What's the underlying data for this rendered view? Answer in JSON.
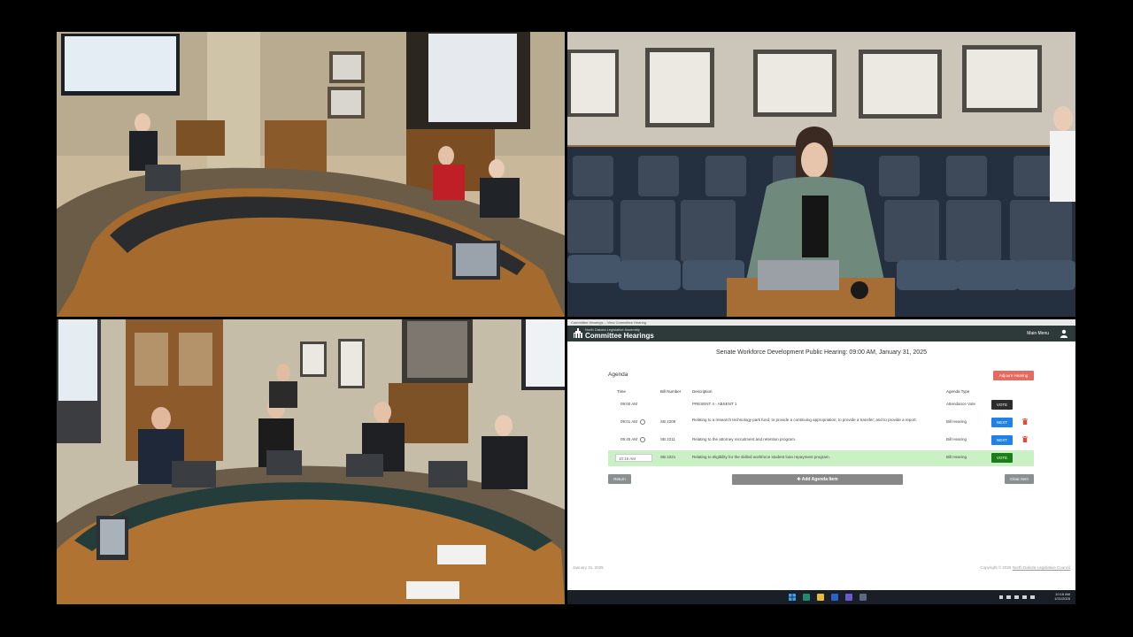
{
  "browser": {
    "title": "Committee Hearings – View Committee Hearing"
  },
  "app": {
    "org": "North Dakota Legislative Assembly",
    "title": "Committee Hearings",
    "menu_label": "Main Menu"
  },
  "hearing_title": "Senate Workforce Development Public Hearing: 09:00 AM, January 31, 2025",
  "agenda": {
    "label": "Agenda",
    "adjourn_label": "Adjourn Hearing",
    "headers": {
      "time": "Time",
      "bill": "Bill Number",
      "description": "Description",
      "type": "Agenda Type"
    },
    "rows": [
      {
        "time": "09:00 AM",
        "bill": "",
        "description": "PRESENT 4 - ABSENT 1",
        "type": "Attendance Vote",
        "action": "VOTE"
      },
      {
        "time": "09:01 AM",
        "bill": "SB 2209",
        "description": "Relating to a research technology park fund; to provide a continuing appropriation; to provide a transfer; and to provide a report.",
        "type": "Bill Hearing",
        "action": "NEXT"
      },
      {
        "time": "09:45 AM",
        "bill": "SB 2211",
        "description": "Relating to the attorney recruitment and retention program.",
        "type": "Bill Hearing",
        "action": "NEXT"
      },
      {
        "time": "10:15 AM",
        "bill": "SB 2221",
        "description": "Relating to eligibility for the skilled workforce student loan repayment program.",
        "type": "Bill Hearing",
        "action": "VOTE"
      }
    ],
    "return_label": "Return",
    "add_label": "✚ Add Agenda Item",
    "clear_label": "Clear Item"
  },
  "footer": {
    "date": "January 31, 2025",
    "copyright": "Copyright © 2025",
    "org_link": "North Dakota Legislative Council"
  },
  "taskbar": {
    "time": "10:16 AM",
    "date": "1/31/2025"
  },
  "colors": {
    "header": "#2e3a3a",
    "adjourn": "#e46b5f",
    "next": "#1e82e8",
    "vote_current": "#1a7f1a",
    "current_row": "#c9f1c4"
  }
}
